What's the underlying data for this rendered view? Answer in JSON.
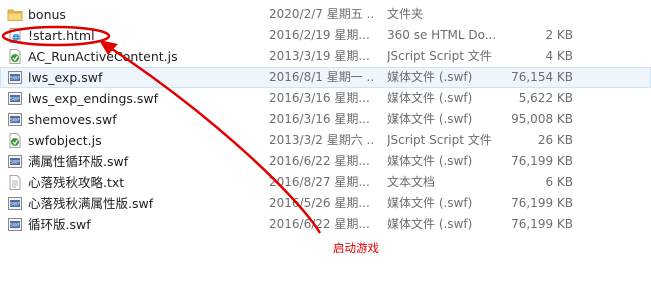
{
  "files": [
    {
      "name": "bonus",
      "date": "2020/2/7 星期五 ...",
      "type": "文件夹",
      "size": "",
      "icon": "folder-icon"
    },
    {
      "name": "!start.html",
      "date": "2016/2/19 星期...",
      "type": "360 se HTML Do...",
      "size": "2 KB",
      "icon": "html-file-icon"
    },
    {
      "name": "AC_RunActiveContent.js",
      "date": "2013/3/19 星期...",
      "type": "JScript Script 文件",
      "size": "4 KB",
      "icon": "js-file-icon"
    },
    {
      "name": "lws_exp.swf",
      "date": "2016/8/1 星期一 ...",
      "type": "媒体文件 (.swf)",
      "size": "76,154 KB",
      "icon": "swf-file-icon",
      "highlighted": true
    },
    {
      "name": "lws_exp_endings.swf",
      "date": "2016/3/16 星期...",
      "type": "媒体文件 (.swf)",
      "size": "5,622 KB",
      "icon": "swf-file-icon"
    },
    {
      "name": "shemoves.swf",
      "date": "2016/3/16 星期...",
      "type": "媒体文件 (.swf)",
      "size": "95,008 KB",
      "icon": "swf-file-icon"
    },
    {
      "name": "swfobject.js",
      "date": "2013/3/2 星期六 ...",
      "type": "JScript Script 文件",
      "size": "26 KB",
      "icon": "js-file-icon"
    },
    {
      "name": "满属性循环版.swf",
      "date": "2016/6/22 星期...",
      "type": "媒体文件 (.swf)",
      "size": "76,199 KB",
      "icon": "swf-file-icon"
    },
    {
      "name": "心落残秋攻略.txt",
      "date": "2016/8/27 星期...",
      "type": "文本文档",
      "size": "6 KB",
      "icon": "txt-file-icon"
    },
    {
      "name": "心落残秋满属性版.swf",
      "date": "2016/5/26 星期...",
      "type": "媒体文件 (.swf)",
      "size": "76,199 KB",
      "icon": "swf-file-icon"
    },
    {
      "name": "循环版.swf",
      "date": "2016/6/22 星期...",
      "type": "媒体文件 (.swf)",
      "size": "76,199 KB",
      "icon": "swf-file-icon"
    }
  ],
  "annotation": {
    "text": "启动游戏",
    "color": "#e00000"
  }
}
